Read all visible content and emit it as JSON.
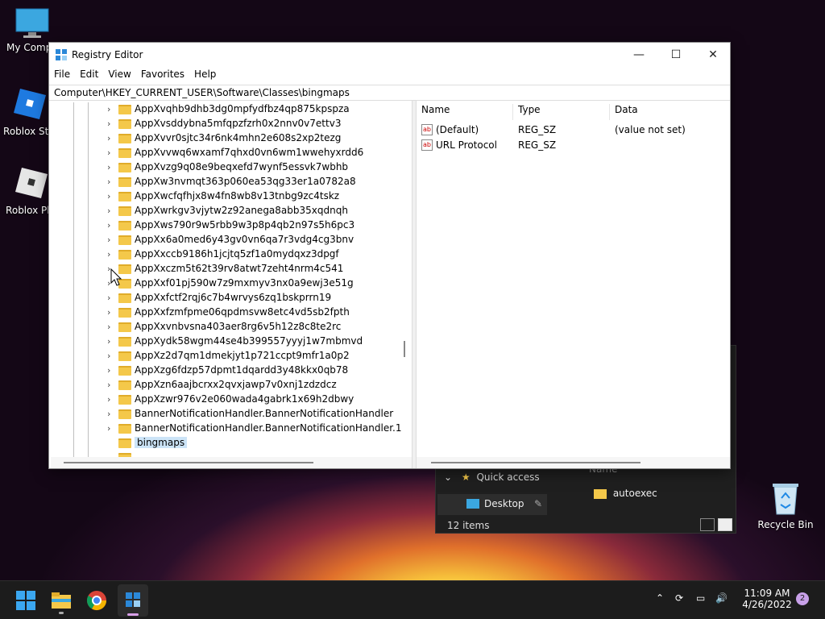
{
  "desktop": {
    "icons": [
      {
        "label": "My Compu",
        "icon": "monitor-icon"
      },
      {
        "label": "Roblox Stu",
        "icon": "roblox-studio-icon"
      },
      {
        "label": "Roblox Pla",
        "icon": "roblox-player-icon"
      },
      {
        "label": "Recycle Bin",
        "icon": "recycle-bin-icon"
      }
    ]
  },
  "explorer": {
    "header": "Name",
    "quick_access": "Quick access",
    "desktop_item": "Desktop",
    "folder": "autoexec",
    "item_count": "12 items"
  },
  "regedit": {
    "title": "Registry Editor",
    "menu": [
      "File",
      "Edit",
      "View",
      "Favorites",
      "Help"
    ],
    "address": "Computer\\HKEY_CURRENT_USER\\Software\\Classes\\bingmaps",
    "tree": [
      "AppXvqhb9dhb3dg0mpfydfbz4qp875kpspza",
      "AppXvsddybna5mfqpzfzrh0x2nnv0v7ettv3",
      "AppXvvr0sjtc34r6nk4mhn2e608s2xp2tezg",
      "AppXvvwq6wxamf7qhxd0vn6wm1wwehyxrdd6",
      "AppXvzg9q08e9beqxefd7wynf5essvk7wbhb",
      "AppXw3nvmqt363p060ea53qg33er1a0782a8",
      "AppXwcfqfhjx8w4fn8wb8v13tnbg9zc4tskz",
      "AppXwrkgv3vjytw2z92anega8abb35xqdnqh",
      "AppXws790r9w5rbb9w3p8p4qb2n97s5h6pc3",
      "AppXx6a0med6y43gv0vn6qa7r3vdg4cg3bnv",
      "AppXxccb9186h1jcjtq5zf1a0mydqxz3dpgf",
      "AppXxczm5t62t39rv8atwt7zeht4nrm4c541",
      "AppXxf01pj590w7z9mxmyv3nx0a9ewj3e51g",
      "AppXxfctf2rqj6c7b4wrvys6zq1bskprrn19",
      "AppXxfzmfpme06qpdmsvw8etc4vd5sb2fpth",
      "AppXxvnbvsna403aer8rg6v5h12z8c8te2rc",
      "AppXydk58wgm44se4b399557yyyj1w7mbmvd",
      "AppXz2d7qm1dmekjyt1p721ccpt9mfr1a0p2",
      "AppXzg6fdzp57dpmt1dqardd3y48kkx0qb78",
      "AppXzn6aajbcrxx2qvxjawp7v0xnj1zdzdcz",
      "AppXzwr976v2e060wada4gabrk1x69h2dbwy",
      "BannerNotificationHandler.BannerNotificationHandler",
      "BannerNotificationHandler.BannerNotificationHandler.1",
      "bingmaps"
    ],
    "selected": "bingmaps",
    "columns": [
      "Name",
      "Type",
      "Data"
    ],
    "values": [
      {
        "name": "(Default)",
        "type": "REG_SZ",
        "data": "(value not set)"
      },
      {
        "name": "URL Protocol",
        "type": "REG_SZ",
        "data": ""
      }
    ]
  },
  "taskbar": {
    "pinned": [
      "start-icon",
      "file-explorer-icon",
      "chrome-icon",
      "regedit-icon"
    ],
    "time": "11:09 AM",
    "date": "4/26/2022",
    "notification_count": "2"
  }
}
